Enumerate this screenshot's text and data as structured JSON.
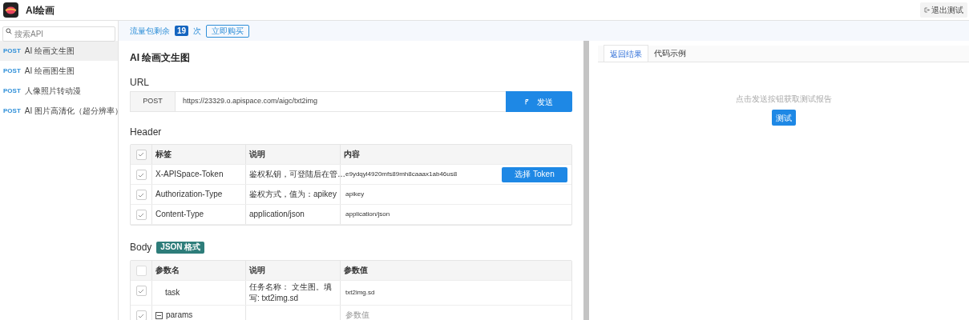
{
  "app": {
    "title": "AI绘画",
    "exit_button": "退出测试"
  },
  "sidebar": {
    "search": {
      "placeholder": "搜索API"
    },
    "items": [
      {
        "method": "POST",
        "label": "AI 绘画文生图",
        "selected": true
      },
      {
        "method": "POST",
        "label": "AI 绘画图生图",
        "selected": false
      },
      {
        "method": "POST",
        "label": "人像照片转动漫",
        "selected": false
      },
      {
        "method": "POST",
        "label": "AI 图片高清化（超分辨率）",
        "selected": false
      }
    ]
  },
  "quota": {
    "prefix": "流量包剩余",
    "count": "19",
    "suffix": "次",
    "buy_button": "立即购买"
  },
  "main": {
    "title": "AI 绘画文生图",
    "url_heading": "URL",
    "method": "POST",
    "url": "https://23329.o.apispace.com/aigc/txt2img",
    "send_button": "发送",
    "header_heading": "Header",
    "header_table": {
      "all_checked": true,
      "columns": [
        "标签",
        "说明",
        "内容"
      ],
      "rows": [
        {
          "checked": true,
          "name": "X-APISpace-Token",
          "desc": "鉴权私钥，可登陆后在管…",
          "value": "e9ydqyl4920mfs89mh8caaax1ab46us8",
          "action": "选择 Token"
        },
        {
          "checked": true,
          "name": "Authorization-Type",
          "desc": "鉴权方式，值为：apikey",
          "value": "apikey"
        },
        {
          "checked": true,
          "name": "Content-Type",
          "desc": "application/json",
          "value": "application/json"
        }
      ]
    },
    "body_heading": "Body",
    "body_badge": "JSON 格式",
    "body_table": {
      "all_checked": false,
      "columns": [
        "参数名",
        "说明",
        "参数值"
      ],
      "rows": [
        {
          "checked": true,
          "kind": "leaf",
          "name": "task",
          "desc": "任务名称： 文生图。填写: txt2img.sd",
          "value": "txt2img.sd"
        },
        {
          "checked": true,
          "kind": "group",
          "name": "params",
          "desc": "",
          "placeholder": "参数值"
        }
      ]
    }
  },
  "result": {
    "tabs": [
      {
        "label": "返回结果",
        "selected": true
      },
      {
        "label": "代码示例",
        "selected": false
      }
    ],
    "hint": "点击发送按钮获取测试报告",
    "test_button": "测试"
  }
}
